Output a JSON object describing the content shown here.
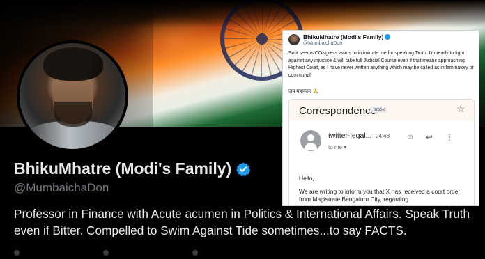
{
  "profile": {
    "display_name": "BhikuMhatre (Modi's Family)",
    "handle": "@MumbaichaDon",
    "bio": "Professor in Finance with Acute acumen in Politics & International Affairs. Speak Truth even if Bitter. Compelled to Swim Against Tide sometimes...to say FACTS."
  },
  "tweet": {
    "author_name": "BhikuMhatre (Modi's Family)",
    "author_handle": "@MumbaichaDon",
    "text": "So it seems CONgress wants to intimidate me for speaking Truth. I'm ready to fight against any injustice & will take full Judicial Course even if that means approaching Highest Court, as I have never written anything which may be called as inflammatory or communal.",
    "sign_off": "जय महाकाल 🙏"
  },
  "email": {
    "subject": "Correspondence",
    "badge": "Inbox",
    "sender": "twitter-legal...",
    "time": "04:48",
    "to": "to me ▾",
    "greeting": "Hello,",
    "body": "We are writing to inform you that X has received a court order from Magistrate Bengaluru City, regarding"
  },
  "colors": {
    "background": "#000000",
    "verified": "#1d9bf0",
    "handle_gray": "#71767b"
  },
  "icons": [
    "verified-icon",
    "star-icon",
    "emoji-icon",
    "reply-icon",
    "more-icon"
  ]
}
